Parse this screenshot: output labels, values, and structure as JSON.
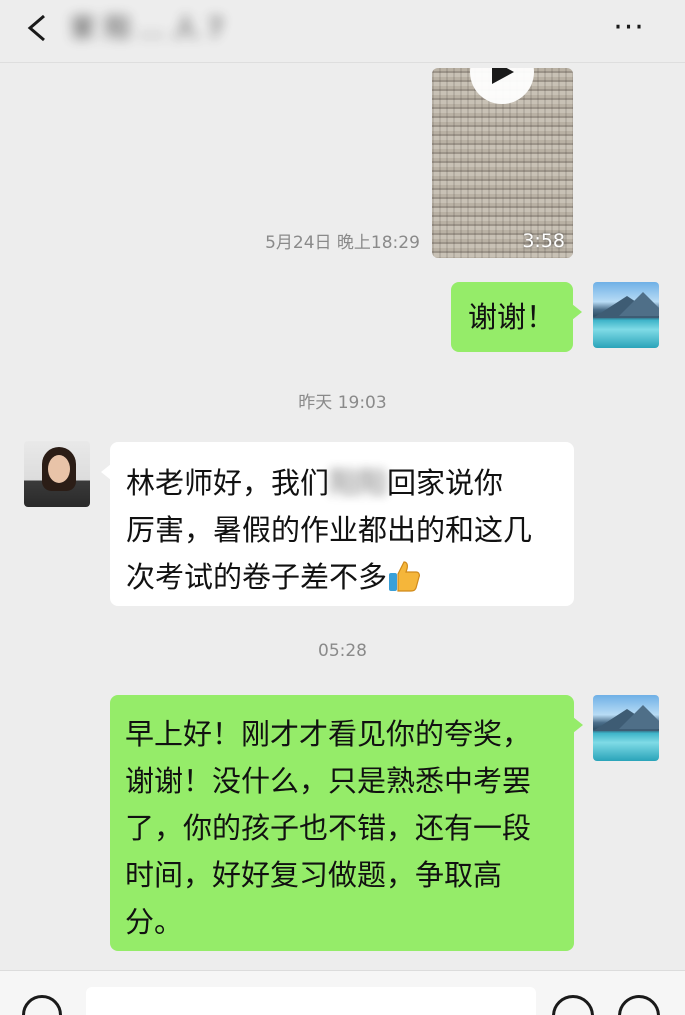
{
  "header": {
    "title": "家 阳 … 人 7",
    "more_label": "···"
  },
  "messages": {
    "video": {
      "duration": "3:58"
    },
    "ts1": "5月24日 晚上18:29",
    "msg1": "谢谢！",
    "ts2": "昨天 19:03",
    "msg2": {
      "line1_a": "林老师好，我们",
      "line1_blur": "阳阳",
      "line1_b": "回家说你",
      "line2": "厉害，暑假的作业都出的和这几",
      "line3": "次考试的卷子差不多"
    },
    "ts3": "05:28",
    "msg3": {
      "line1": "早上好！刚才才看见你的夸奖，",
      "line2": "谢谢！没什么，只是熟悉中考罢",
      "line3": "了，你的孩子也不错，还有一段",
      "line4": "时间，好好复习做题，争取高",
      "line5": "分。"
    }
  },
  "icons": {
    "back": "chevron-left-icon",
    "more": "more-dots-icon",
    "play": "play-icon",
    "thumbs_up": "thumbs-up-emoji",
    "voice": "voice-icon",
    "emoji": "emoji-icon",
    "plus": "plus-icon"
  },
  "colors": {
    "background": "#ededed",
    "sent_bubble": "#95ec69",
    "received_bubble": "#ffffff",
    "timestamp": "#8a8a8a"
  }
}
